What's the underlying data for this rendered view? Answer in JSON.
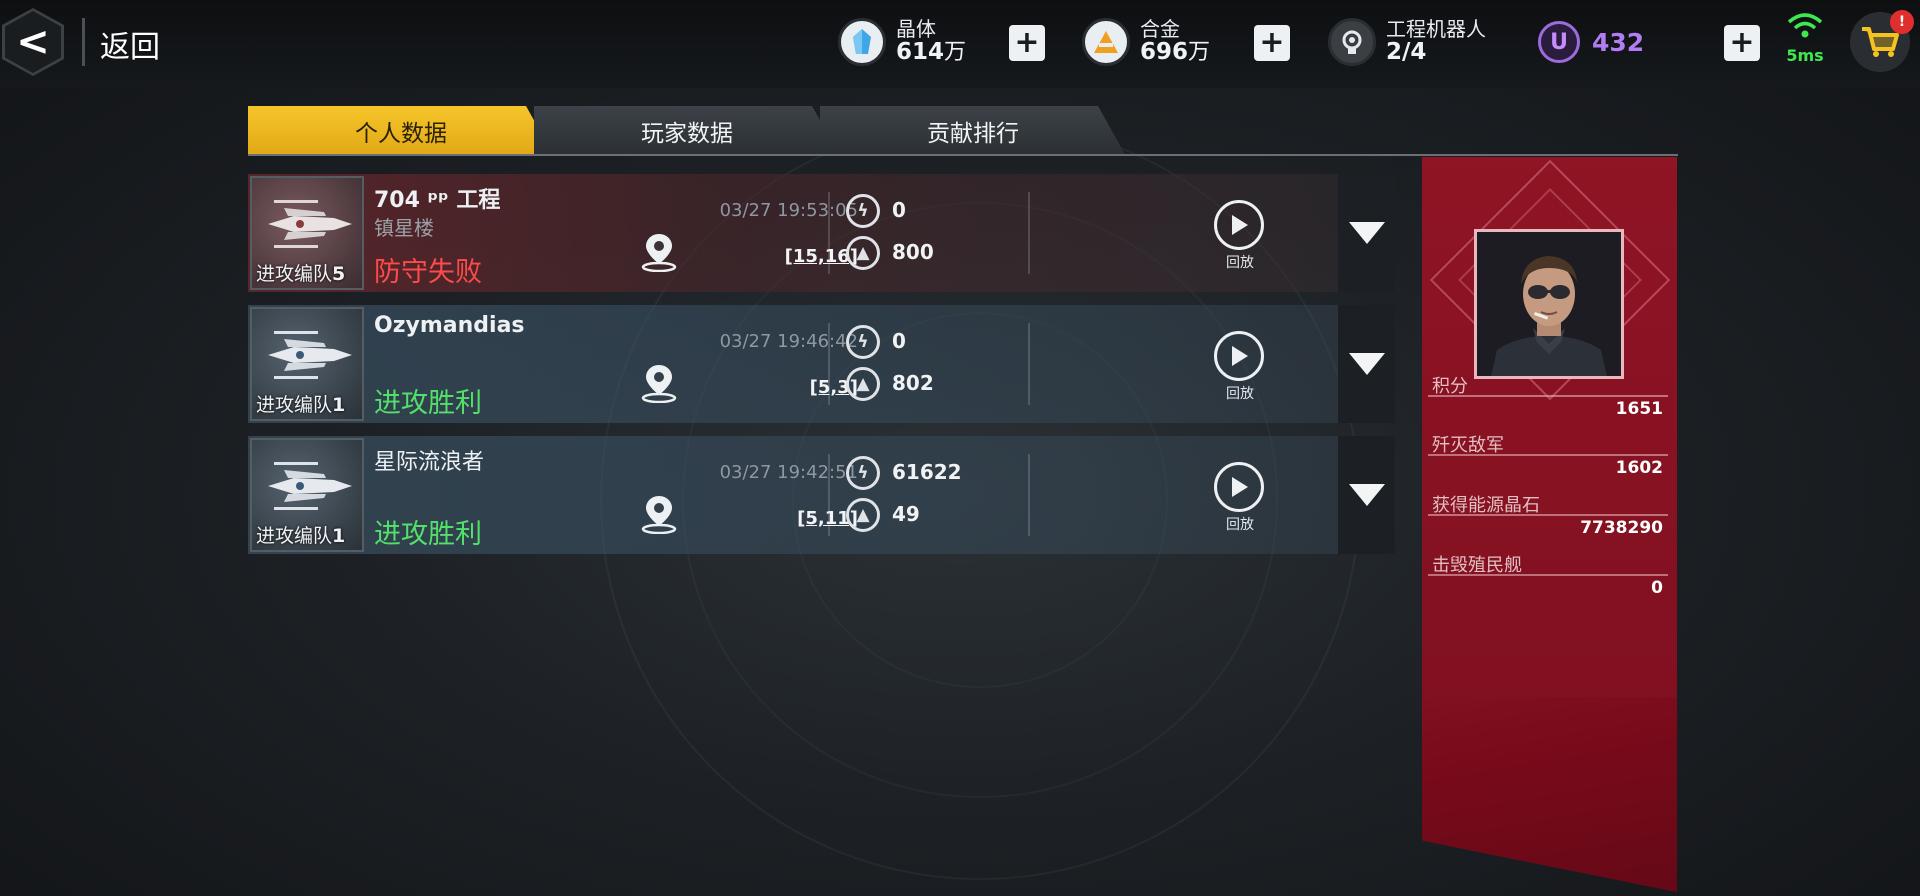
{
  "topbar": {
    "back_label": "返回",
    "resources": [
      {
        "name": "晶体",
        "value": "614",
        "unit": "万",
        "icon": "crystal-icon",
        "color": "#3fa6e8"
      },
      {
        "name": "合金",
        "value": "696",
        "unit": "万",
        "icon": "alloy-icon",
        "color": "#f0a020"
      },
      {
        "name": "工程机器人",
        "value": "2/4",
        "unit": "",
        "icon": "robot-icon",
        "color": "#d0d4d8"
      }
    ],
    "uranium": {
      "value": "432",
      "icon": "uranium-icon",
      "letter": "U",
      "color": "#b27df2"
    },
    "ping": "5ms",
    "cart_badge": "!"
  },
  "tabs": [
    {
      "label": "个人数据",
      "active": true
    },
    {
      "label": "玩家数据",
      "active": false
    },
    {
      "label": "贡献排行",
      "active": false
    }
  ],
  "records": [
    {
      "fleet_label": "进攻编队",
      "fleet_no": "5",
      "opponent": "704 ᵖᵖ 工程",
      "alliance": "镇星楼",
      "result": "防守失败",
      "result_type": "loss",
      "time": "03/27 19:53:05",
      "coords": "[15,16]",
      "energy": "0",
      "fleet_stat": "800",
      "replay_label": "回放"
    },
    {
      "fleet_label": "进攻编队",
      "fleet_no": "1",
      "opponent": "Ozymandias",
      "alliance": "",
      "result": "进攻胜利",
      "result_type": "win",
      "time": "03/27 19:46:42",
      "coords": "[5,3]",
      "energy": "0",
      "fleet_stat": "802",
      "replay_label": "回放"
    },
    {
      "fleet_label": "进攻编队",
      "fleet_no": "1",
      "opponent": "星际流浪者",
      "alliance": "",
      "result": "进攻胜利",
      "result_type": "win",
      "time": "03/27 19:42:51",
      "coords": "[5,11]",
      "energy": "61622",
      "fleet_stat": "49",
      "replay_label": "回放"
    }
  ],
  "panel": {
    "stats": [
      {
        "label": "积分",
        "value": "1651"
      },
      {
        "label": "歼灭敌军",
        "value": "1602"
      },
      {
        "label": "获得能源晶石",
        "value": "7738290"
      },
      {
        "label": "击毁殖民舰",
        "value": "0"
      }
    ]
  }
}
